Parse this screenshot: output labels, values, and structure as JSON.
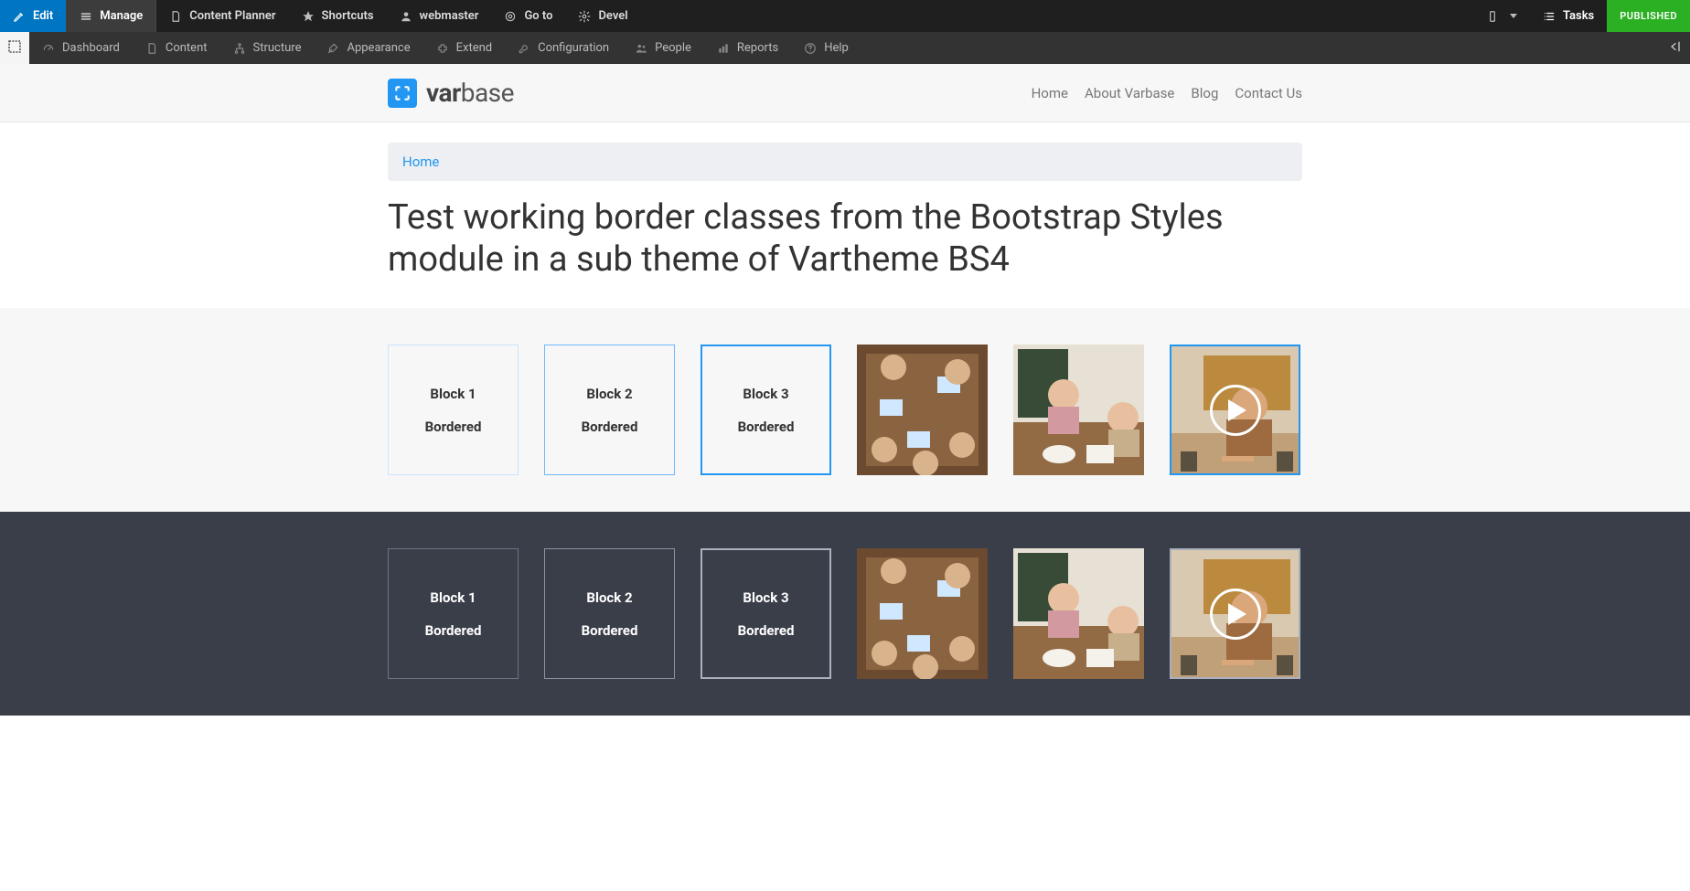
{
  "toolbar": {
    "edit": "Edit",
    "manage": "Manage",
    "content_planner": "Content Planner",
    "shortcuts": "Shortcuts",
    "user": "webmaster",
    "goto": "Go to",
    "devel": "Devel",
    "tasks": "Tasks",
    "published": "PUBLISHED"
  },
  "adminmenu": {
    "dashboard": "Dashboard",
    "content": "Content",
    "structure": "Structure",
    "appearance": "Appearance",
    "extend": "Extend",
    "configuration": "Configuration",
    "people": "People",
    "reports": "Reports",
    "help": "Help"
  },
  "site": {
    "logo_text_prefix": "var",
    "logo_text_suffix": "base",
    "nav": {
      "home": "Home",
      "about": "About Varbase",
      "blog": "Blog",
      "contact": "Contact Us"
    }
  },
  "breadcrumb": {
    "home": "Home"
  },
  "page": {
    "title": "Test working border classes from the Bootstrap Styles module in a sub theme of Vartheme BS4"
  },
  "blocks": {
    "b1": {
      "title": "Block 1",
      "subtitle": "Bordered"
    },
    "b2": {
      "title": "Block 2",
      "subtitle": "Bordered"
    },
    "b3": {
      "title": "Block 3",
      "subtitle": "Bordered"
    }
  }
}
